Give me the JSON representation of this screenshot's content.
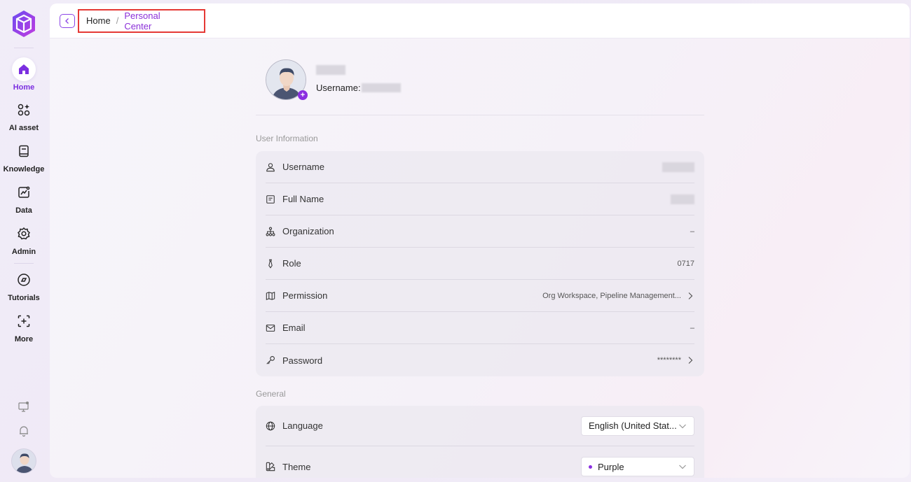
{
  "sidebar": {
    "items": [
      {
        "label": "Home",
        "icon": "home-icon",
        "active": true
      },
      {
        "label": "AI asset",
        "icon": "ai-asset-icon"
      },
      {
        "label": "Knowledge",
        "icon": "book-icon"
      },
      {
        "label": "Data",
        "icon": "chart-icon"
      },
      {
        "label": "Admin",
        "icon": "gear-icon"
      },
      {
        "label": "Tutorials",
        "icon": "tutorials-icon"
      },
      {
        "label": "More",
        "icon": "more-icon"
      }
    ]
  },
  "breadcrumb": {
    "home": "Home",
    "separator": "/",
    "current": "Personal Center"
  },
  "profile": {
    "username_label": "Username:"
  },
  "user_info": {
    "title": "User Information",
    "rows": [
      {
        "label": "Username",
        "value": ""
      },
      {
        "label": "Full Name",
        "value": ""
      },
      {
        "label": "Organization",
        "value": "–"
      },
      {
        "label": "Role",
        "value": "0717"
      },
      {
        "label": "Permission",
        "value": "Org Workspace, Pipeline Management..."
      },
      {
        "label": "Email",
        "value": "–"
      },
      {
        "label": "Password",
        "value": "********"
      }
    ]
  },
  "general": {
    "title": "General",
    "language_label": "Language",
    "language_value": "English (United Stat...",
    "theme_label": "Theme",
    "theme_value": "Purple"
  },
  "colors": {
    "accent": "#8b2fe0",
    "highlight_border": "#e53935"
  }
}
